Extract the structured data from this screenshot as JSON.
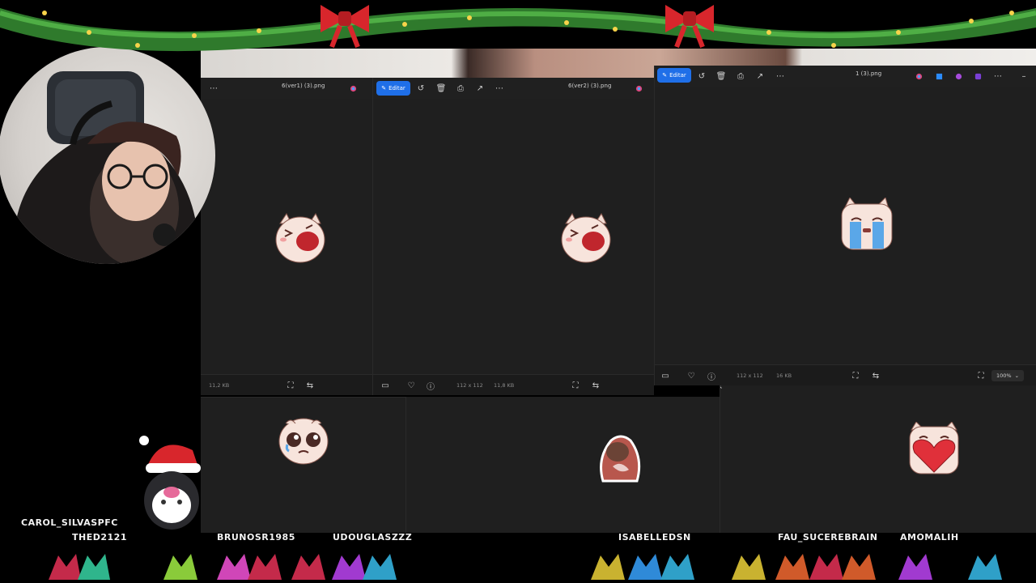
{
  "windows": {
    "left": {
      "title": "6(ver1) (3).png",
      "size_kb": "11,2 KB"
    },
    "middle": {
      "title": "6(ver2) (3).png",
      "edit_label": "Editar",
      "dimensions": "112 x 112",
      "size_kb": "11,8 KB"
    },
    "right": {
      "title": "1 (3).png",
      "edit_label": "Editar",
      "dimensions": "112 x 112",
      "size_kb": "16 KB",
      "zoom": "100%"
    }
  },
  "chat_names": {
    "carol": "CAROL_SILVASPFC",
    "thed": "THED2121",
    "bruno": "BRUNOSR1985",
    "douglas": "UDOUGLASZZZ",
    "isabelle": "ISABELLEDSN",
    "fau": "FAU_SUCEREBRAIN",
    "amo": "AMOMALIH"
  },
  "colors": {
    "accent": "#1f6fe8",
    "window_bg": "#1f1f1f",
    "text": "#cfcfcf"
  },
  "icons": [
    "rotate-icon",
    "delete-icon",
    "print-icon",
    "share-icon",
    "more-icon",
    "favorite-icon",
    "info-icon",
    "fit-icon",
    "compare-icon",
    "minimize-icon",
    "edit-icon",
    "filmstrip-icon",
    "zoom-chevron-icon"
  ]
}
